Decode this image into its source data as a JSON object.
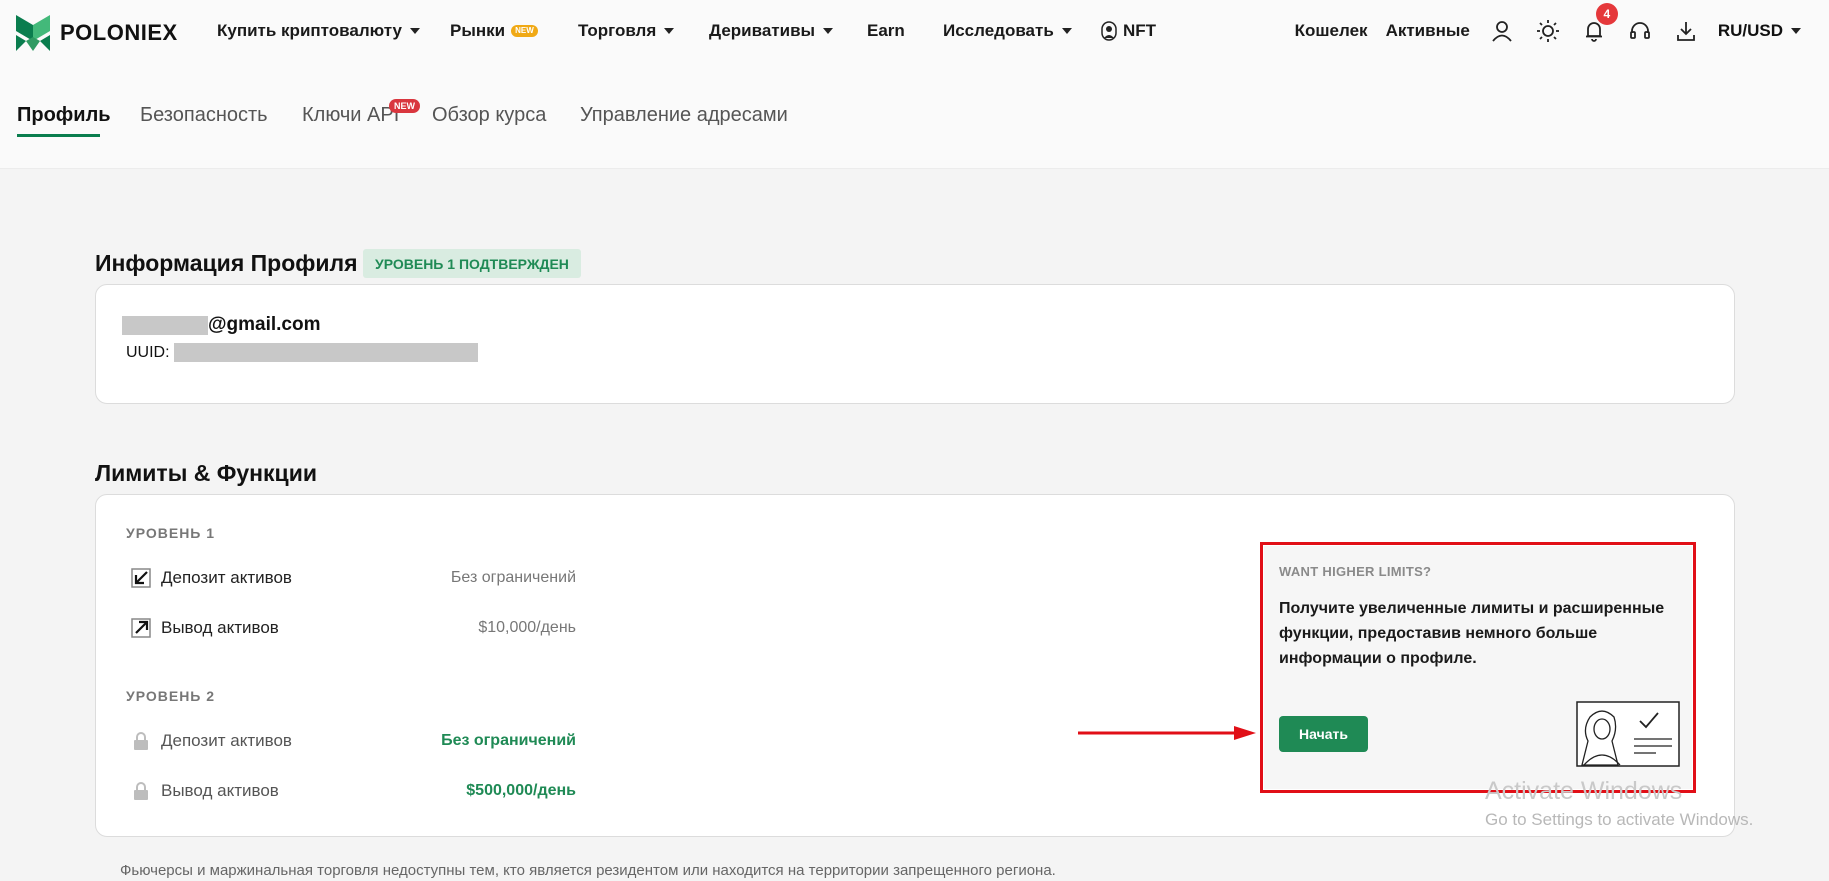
{
  "brand": {
    "name": "POLONIEX",
    "color": "#0a7d4e"
  },
  "nav": {
    "items": [
      {
        "label": "Купить криптовалюту",
        "dropdown": true
      },
      {
        "label": "Рынки",
        "badge": "NEW"
      },
      {
        "label": "Торговля",
        "dropdown": true
      },
      {
        "label": "Деривативы",
        "dropdown": true
      },
      {
        "label": "Earn"
      },
      {
        "label": "Исследовать",
        "dropdown": true
      },
      {
        "label": "NFT"
      }
    ],
    "wallet": "Кошелек",
    "assets": "Активные",
    "notifications_count": "4",
    "locale": "RU/USD"
  },
  "subnav": {
    "tabs": [
      "Профиль",
      "Безопасность",
      "Ключи API",
      "Обзор курса",
      "Управление адресами"
    ],
    "active_tab": "Профиль",
    "api_badge": "NEW"
  },
  "profile": {
    "title": "Информация Профиля",
    "level_badge": "УРОВЕНЬ 1 ПОДТВЕРЖДЕН",
    "email_domain": "@gmail.com",
    "uuid_label": "UUID:"
  },
  "limits": {
    "title": "Лимиты & Функции",
    "level1": {
      "label": "УРОВЕНЬ 1",
      "deposit_label": "Депозит активов",
      "deposit_value": "Без ограничений",
      "withdraw_label": "Вывод активов",
      "withdraw_value": "$10,000/день"
    },
    "level2": {
      "label": "УРОВЕНЬ 2",
      "deposit_label": "Депозит активов",
      "deposit_value": "Без ограничений",
      "withdraw_label": "Вывод активов",
      "withdraw_value": "$500,000/день"
    }
  },
  "promo": {
    "kicker": "WANT HIGHER LIMITS?",
    "text": "Получите увеличенные лимиты и расширенные функции, предоставив немного больше информации о профиле.",
    "button": "Начать"
  },
  "watermark": {
    "line1": "Activate Windows",
    "line2": "Go to Settings to activate Windows."
  },
  "footnote": "Фьючерсы и маржинальная торговля недоступны тем, кто является резидентом или находится на территории запрещенного региона.",
  "colors": {
    "accent_green": "#1f8a55",
    "annotation_red": "#e10f17",
    "notification_red": "#e5383b"
  }
}
